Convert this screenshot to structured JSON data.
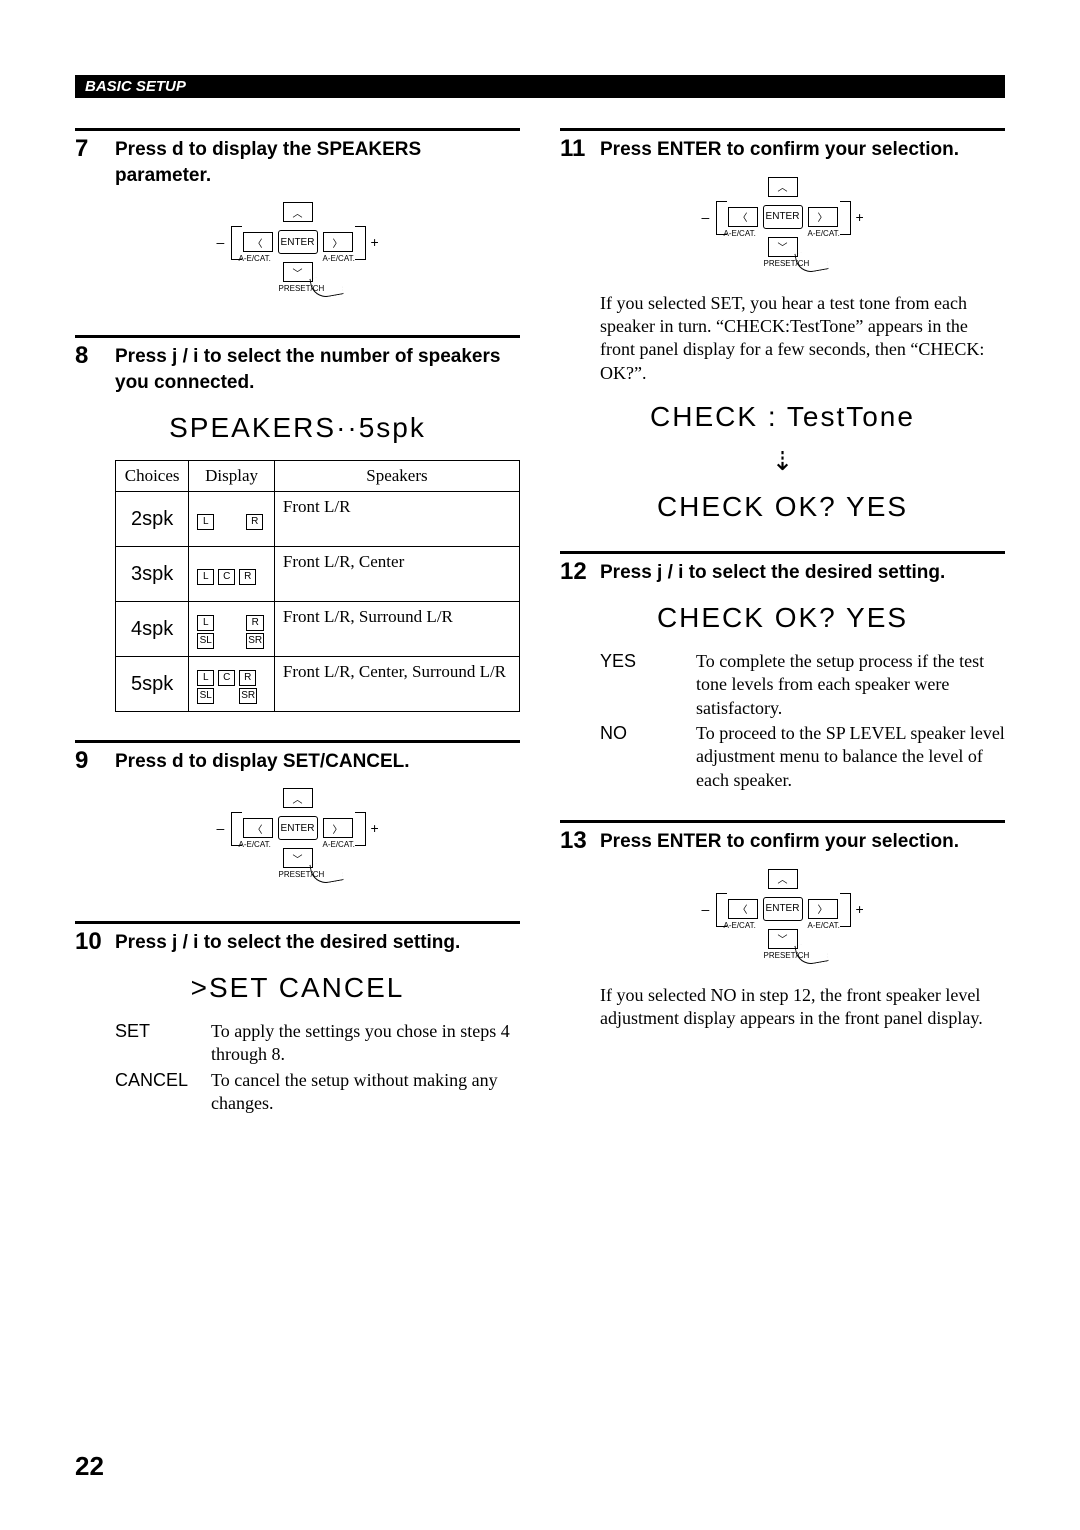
{
  "header": "BASIC SETUP",
  "pad": {
    "enter": "ENTER",
    "left_label": "A-E/CAT.",
    "right_label": "A-E/CAT.",
    "bottom_label": "PRESET/CH",
    "minus": "–",
    "plus": "+",
    "up_glyph": "︿",
    "down_glyph": "﹀",
    "left_glyph": "〈",
    "right_glyph": "〉"
  },
  "left": {
    "step7": {
      "num": "7",
      "text": "Press d to display the SPEAKERS parameter."
    },
    "step8": {
      "num": "8",
      "text": "Press j / i to select the number of speakers you connected.",
      "lcd": "SPEAKERS··5spk",
      "table": {
        "headers": [
          "Choices",
          "Display",
          "Speakers"
        ],
        "rows": [
          {
            "choice": "2spk",
            "display": [
              "L",
              "R"
            ],
            "surround": [],
            "speakers": "Front L/R"
          },
          {
            "choice": "3spk",
            "display": [
              "L",
              "C",
              "R"
            ],
            "surround": [],
            "speakers": "Front L/R, Center"
          },
          {
            "choice": "4spk",
            "display": [
              "L",
              "R"
            ],
            "surround": [
              "SL",
              "SR"
            ],
            "speakers": "Front L/R, Surround L/R"
          },
          {
            "choice": "5spk",
            "display": [
              "L",
              "C",
              "R"
            ],
            "surround": [
              "SL",
              "SR"
            ],
            "speakers": "Front L/R, Center, Surround L/R"
          }
        ]
      }
    },
    "step9": {
      "num": "9",
      "text": "Press d to display SET/CANCEL."
    },
    "step10": {
      "num": "10",
      "text": "Press j / i to select the desired setting.",
      "lcd": ">SET   CANCEL",
      "defs": [
        {
          "term": "SET",
          "desc": "To apply the settings you chose in steps 4 through 8."
        },
        {
          "term": "CANCEL",
          "desc": "To cancel the setup without making any changes."
        }
      ]
    }
  },
  "right": {
    "step11": {
      "num": "11",
      "text": "Press ENTER to confirm your selection.",
      "para": "If you selected SET, you hear a test tone from each speaker in turn. “CHECK:TestTone” appears in the front panel display for a few seconds, then “CHECK: OK?”.",
      "lcd1": "CHECK : TestTone",
      "lcd2": "CHECK OK?   YES"
    },
    "step12": {
      "num": "12",
      "text": "Press j / i to select the desired setting.",
      "lcd": "CHECK OK?   YES",
      "defs": [
        {
          "term": "YES",
          "desc": "To complete the setup process if the test tone levels from each speaker were satisfactory."
        },
        {
          "term": "NO",
          "desc": "To proceed to the SP LEVEL speaker level adjustment menu to balance the level of each speaker."
        }
      ]
    },
    "step13": {
      "num": "13",
      "text": "Press ENTER to confirm your selection.",
      "para": "If you selected NO in step 12, the front speaker level adjustment display appears in the front panel display."
    }
  },
  "pagenum": "22"
}
